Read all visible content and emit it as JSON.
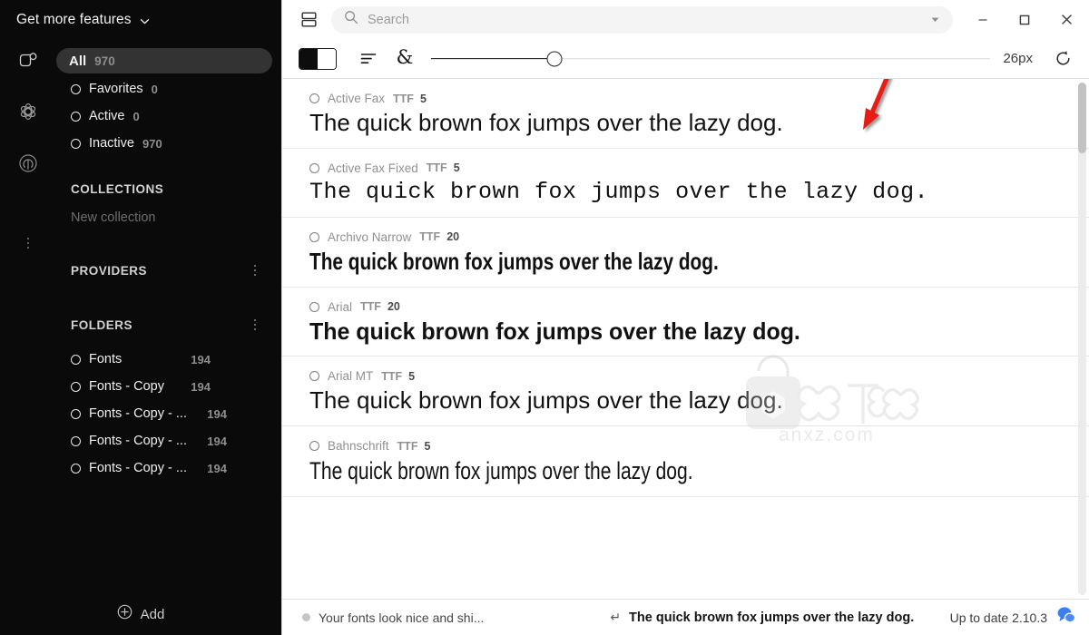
{
  "sidebar": {
    "header": {
      "label": "Get more features",
      "icon": "chevron-down-icon"
    },
    "rail_icons": [
      "library-icon",
      "atom-icon",
      "broadcast-icon"
    ],
    "all_item": {
      "label": "All",
      "count": "970"
    },
    "filters": [
      {
        "label": "Favorites",
        "count": "0"
      },
      {
        "label": "Active",
        "count": "0"
      },
      {
        "label": "Inactive",
        "count": "970"
      }
    ],
    "collections": {
      "title": "COLLECTIONS",
      "empty_label": "New collection"
    },
    "providers": {
      "title": "PROVIDERS"
    },
    "folders": {
      "title": "FOLDERS",
      "items": [
        {
          "label": "Fonts",
          "count": "194"
        },
        {
          "label": "Fonts - Copy",
          "count": "194"
        },
        {
          "label": "Fonts - Copy - ...",
          "count": "194"
        },
        {
          "label": "Fonts - Copy - ...",
          "count": "194"
        },
        {
          "label": "Fonts - Copy - ...",
          "count": "194"
        }
      ]
    },
    "footer": {
      "label": "Add",
      "icon": "plus-circle-icon"
    }
  },
  "titlebar": {
    "panel_toggle_icon": "panel-layout-icon",
    "search": {
      "placeholder": "Search",
      "value": "",
      "icon": "search-icon",
      "caret_icon": "chevron-down-icon"
    },
    "window_controls": {
      "minimize": "minimize-icon",
      "maximize": "maximize-icon",
      "close": "close-icon"
    }
  },
  "toolbar": {
    "contrast_toggle_icon": "contrast-toggle-icon",
    "align_icon": "text-align-icon",
    "glyph_icon": "ampersand-icon",
    "glyph_char": "&",
    "slider": {
      "value": 26,
      "min": 10,
      "max": 120,
      "percent": 22
    },
    "size_label": "26px",
    "reset_icon": "reset-icon"
  },
  "font_list": [
    {
      "name": "Active Fax",
      "format": "TTF",
      "count": "5",
      "sample": "The quick brown fox jumps over the lazy dog.",
      "style": "s-sans"
    },
    {
      "name": "Active Fax Fixed",
      "format": "TTF",
      "count": "5",
      "sample": "The quick brown fox jumps over the lazy dog.",
      "style": "s-mono"
    },
    {
      "name": "Archivo Narrow",
      "format": "TTF",
      "count": "20",
      "sample": "The quick brown fox jumps over the lazy dog.",
      "style": "s-narrow"
    },
    {
      "name": "Arial",
      "format": "TTF",
      "count": "20",
      "sample": "The quick brown fox jumps over the lazy dog.",
      "style": "s-bold"
    },
    {
      "name": "Arial MT",
      "format": "TTF",
      "count": "5",
      "sample": "The quick brown fox jumps over the lazy dog.",
      "style": "s-sans"
    },
    {
      "name": "Bahnschrift",
      "format": "TTF",
      "count": "5",
      "sample": "The quick brown fox jumps over the lazy dog.",
      "style": "s-cond"
    }
  ],
  "statusbar": {
    "message": "Your fonts look nice and shi...",
    "enter_key": "↵",
    "preview_text": "The quick brown fox jumps over the lazy dog.",
    "update_status": "Up to date 2.10.3",
    "chat_icon": "chat-bubbles-icon"
  },
  "watermark": {
    "text": "anxz.com"
  },
  "colors": {
    "sidebar_bg": "#0a0a0a",
    "pill_bg": "#333333",
    "main_bg": "#ffffff",
    "accent_blue": "#3b7ff0",
    "annotation_red": "#e81b15"
  }
}
